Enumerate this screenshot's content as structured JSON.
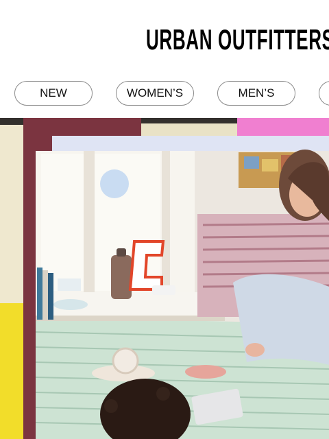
{
  "brand": {
    "logo_text": "URBAN OUTFITTERS"
  },
  "nav": {
    "items": [
      {
        "label": "NEW"
      },
      {
        "label": "WOMEN’S"
      },
      {
        "label": "MEN’S"
      },
      {
        "label": ""
      }
    ]
  },
  "hero": {
    "image": "collage-photo"
  },
  "colors": {
    "background": "#ffffff",
    "text": "#000000",
    "pill_border": "#8a8a8a",
    "maroon": "#7b3440",
    "pink": "#f07fd0",
    "yellow": "#f2dd2a",
    "cream": "#efe8cf"
  }
}
